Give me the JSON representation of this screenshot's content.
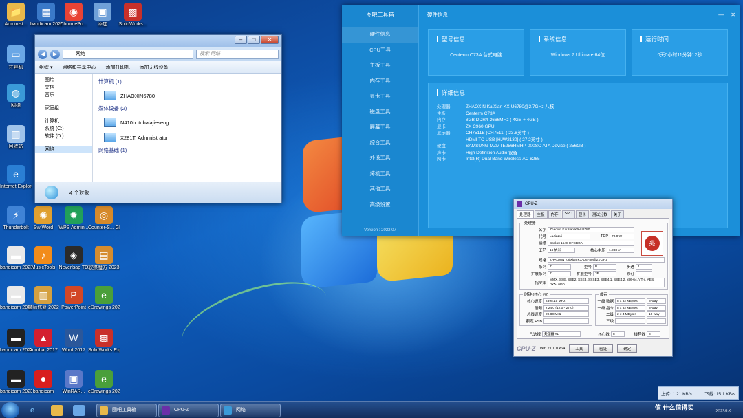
{
  "desktop": {
    "icons": [
      {
        "label": "Administ...",
        "glyph": "📁",
        "color": "#e8b84a"
      },
      {
        "label": "bandicam 2023-01-0...",
        "glyph": "▦",
        "color": "#3a79c8"
      },
      {
        "label": "ChromePo...",
        "glyph": "◉",
        "color": "#e94335"
      },
      {
        "label": "添加",
        "glyph": "▣",
        "color": "#6fa0d8"
      },
      {
        "label": "SolidWorks...",
        "glyph": "▩",
        "color": "#c8302a"
      },
      {
        "label": "计算机",
        "glyph": "▭",
        "color": "#6aa7e6"
      },
      {
        "label": "网络",
        "glyph": "◍",
        "color": "#3a9ad8"
      },
      {
        "label": "回收站",
        "glyph": "▥",
        "color": "#9fc3ea"
      },
      {
        "label": "Internet Explorer",
        "glyph": "e",
        "color": "#2a7fd4"
      },
      {
        "label": "Thunderbolt",
        "glyph": "⚡",
        "color": "#3f83d6"
      },
      {
        "label": "Sw Word",
        "glyph": "✺",
        "color": "#e0a030"
      },
      {
        "label": "WPS Admin...",
        "glyph": "✹",
        "color": "#21a05a"
      },
      {
        "label": "Counter-S... Global Off...",
        "glyph": "◎",
        "color": "#d68a2a"
      },
      {
        "label": "bandicam 2023-01-0...",
        "glyph": "▬",
        "color": "#e9e9e9"
      },
      {
        "label": "MusicTools",
        "glyph": "♪",
        "color": "#f28c1a"
      },
      {
        "label": "Neverlsap TO",
        "glyph": "◈",
        "color": "#2b2b2b"
      },
      {
        "label": "软媒魔方 2023...",
        "glyph": "▤",
        "color": "#d58c2e"
      },
      {
        "label": "bandicam 2023-01-0...",
        "glyph": "▬",
        "color": "#e9e9e9"
      },
      {
        "label": "星际修复 2022",
        "glyph": "▥",
        "color": "#d4a040"
      },
      {
        "label": "PowerPoint",
        "glyph": "P",
        "color": "#d24726"
      },
      {
        "label": "eDrawings 2023 x64...",
        "glyph": "e",
        "color": "#4a9f3a"
      },
      {
        "label": "bandicam 2023-01-0...",
        "glyph": "▬",
        "color": "#222"
      },
      {
        "label": "Acrobat 2017",
        "glyph": "▲",
        "color": "#d41f2f"
      },
      {
        "label": "Word 2017",
        "glyph": "W",
        "color": "#2b579a"
      },
      {
        "label": "SolidWorks Explorer...",
        "glyph": "▩",
        "color": "#c8302a"
      },
      {
        "label": "bandicam 2023-01-0...",
        "glyph": "▬",
        "color": "#222"
      },
      {
        "label": "bandicam",
        "glyph": "●",
        "color": "#d81e1e"
      },
      {
        "label": "WinRAR...",
        "glyph": "▣",
        "color": "#5a78c8"
      },
      {
        "label": "eDrawings 2023",
        "glyph": "e",
        "color": "#4a9f3a"
      }
    ]
  },
  "explorer": {
    "address": "网络",
    "search_placeholder": "搜索 网络",
    "toolbar": [
      "组织 ▾",
      "网络和共享中心",
      "添加打印机",
      "添加无线设备"
    ],
    "nav": [
      "图片",
      "文档",
      "音乐",
      "家庭组",
      "计算机",
      "系统 (C:)",
      "软件 (D:)",
      "网络"
    ],
    "groups": [
      {
        "title": "计算机 (1)",
        "items": [
          "ZHAOXIN6780"
        ]
      },
      {
        "title": "媒体设备 (2)",
        "items": [
          "N410b: tubalajieseng",
          "X281T: Administrator"
        ]
      },
      {
        "title": "网络基础 (1)",
        "items": []
      }
    ],
    "status": "4 个对象"
  },
  "toolbox": {
    "app_title": "图吧工具箱",
    "page_title": "硬件信息",
    "window_buttons": [
      "—",
      "✕"
    ],
    "menu": [
      "硬件信息",
      "CPU工具",
      "主板工具",
      "内存工具",
      "显卡工具",
      "磁盘工具",
      "屏幕工具",
      "综合工具",
      "外设工具",
      "烤机工具",
      "其他工具",
      "高级设置"
    ],
    "version": "Version : 2022.07",
    "cards": [
      {
        "title": "型号信息",
        "value": "Centerm C73A  台式电脑"
      },
      {
        "title": "系统信息",
        "value": "Windows 7 Ultimate 64位"
      },
      {
        "title": "运行时间",
        "value": "0天0小时11分钟12秒"
      }
    ],
    "detail_title": "详细信息",
    "details": [
      {
        "k": "处理器",
        "v": "ZHAOXIN KaiXian KX-U6780@2.7GHz 八核"
      },
      {
        "k": "主板",
        "v": "Centerm C73A"
      },
      {
        "k": "内存",
        "v": "8GB DDR4-2666MHz ( 4GB + 4GB )"
      },
      {
        "k": "显卡",
        "v": "ZX C960 GPU"
      },
      {
        "k": "显示器",
        "v": "CH7511B [CH7511] ( 23.8英寸 )"
      },
      {
        "k": "",
        "v": "HDMI TO USB [HJW2130] ( 27.2英寸 )"
      },
      {
        "k": "硬盘",
        "v": "SAMSUNG MZMTE256HMHP-000SO ATA Device ( 256GB )"
      },
      {
        "k": "声卡",
        "v": "High Definition Audio 设备"
      },
      {
        "k": "网卡",
        "v": "Intel(R) Dual Band Wireless-AC 8265"
      }
    ]
  },
  "cpuz": {
    "title": "CPU-Z",
    "tabs": [
      "处理器",
      "主板",
      "内存",
      "SPD",
      "显卡",
      "测试分数",
      "关于"
    ],
    "processor_label": "处理器",
    "rows": {
      "name_k": "名字",
      "name_v": "Zhaoxin KaiXian KX-U6780",
      "code_k": "代号",
      "code_v": "LuJiaZui",
      "tdp_k": "TDP",
      "tdp_v": "70.0 W",
      "socket_k": "插槽",
      "socket_v": "Socket 1548 HFCBGA",
      "tech_k": "工艺",
      "tech_v": "16 纳米",
      "volt_k": "核心电压",
      "volt_v": "1.288 V",
      "spec_k": "规格",
      "spec_v": "ZHAOXIN KaiXian KX-U6780@2.7GHz",
      "family_k": "系列",
      "family_v": "7",
      "model_k": "型号",
      "model_v": "B",
      "step_k": "步进",
      "step_v": "1",
      "extfam_k": "扩展系列",
      "extfam_v": "7",
      "extmod_k": "扩展型号",
      "extmod_v": "3B",
      "rev_k": "修订",
      "rev_v": "",
      "instr_k": "指令集",
      "instr_v": "MMX, SSE, SSE2, SSE3, SSSE3, SSE4.1, SSE4.2, x86-64, VT-x, AES, AVX, SHA"
    },
    "clocks_label": "时钟 (核心 #0)",
    "clocks": [
      {
        "k": "核心速度",
        "v": "2395.15 MHz"
      },
      {
        "k": "倍频",
        "v": "x 24.0 (12.0 - 27.0)"
      },
      {
        "k": "总线速度",
        "v": "99.80 MHz"
      },
      {
        "k": "额定 FSB",
        "v": ""
      }
    ],
    "cache_label": "缓存",
    "cache": [
      {
        "k": "一级 数据",
        "v": "8 x 32 KBytes",
        "w": "8-way"
      },
      {
        "k": "一级 指令",
        "v": "8 x 32 KBytes",
        "w": "8-way"
      },
      {
        "k": "二级",
        "v": "2 x 4 MBytes",
        "w": "16-way"
      },
      {
        "k": "三级",
        "v": "",
        "w": ""
      }
    ],
    "selected_k": "已选择",
    "selected_v": "处理器 #1",
    "cores_k": "核心数",
    "cores_v": "8",
    "threads_k": "线程数",
    "threads_v": "8",
    "brand": "CPU-Z",
    "version": "Ver. 2.01.0.x64",
    "tools_btn": "工具",
    "validate_btn": "验证",
    "ok_btn": "确定"
  },
  "taskbar": {
    "tasks": [
      "图吧工具箱",
      "CPU-Z",
      "网络"
    ],
    "upload": "上传: 1.21 KB/s",
    "download": "下载: 15.1 KB/s",
    "watermark": "值 什么值得买",
    "date": "2023/1/9"
  }
}
